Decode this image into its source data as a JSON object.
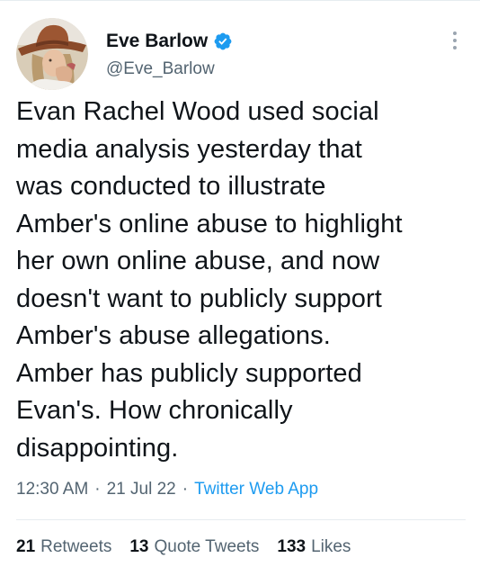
{
  "author": {
    "name": "Eve Barlow",
    "handle": "@Eve_Barlow",
    "verified": true
  },
  "tweet": {
    "text": "Evan Rachel Wood used social\nmedia analysis yesterday that\nwas conducted to illustrate\nAmber's online abuse to highlight\nher own online abuse, and now\ndoesn't want to publicly support\nAmber's abuse allegations.\nAmber has publicly supported\nEvan's. How chronically\ndisappointing.",
    "time": "12:30 AM",
    "date": "21 Jul 22",
    "source": "Twitter Web App",
    "separator": "·"
  },
  "stats": {
    "retweets_count": "21",
    "retweets_label": "Retweets",
    "quotes_count": "13",
    "quotes_label": "Quote Tweets",
    "likes_count": "133",
    "likes_label": "Likes"
  },
  "colors": {
    "text_primary": "#0f1419",
    "text_secondary": "#536471",
    "accent": "#1d9bf0",
    "verified": "#1d9bf0"
  },
  "icons": {
    "verified": "verified-badge-icon",
    "more": "more-options-icon"
  }
}
